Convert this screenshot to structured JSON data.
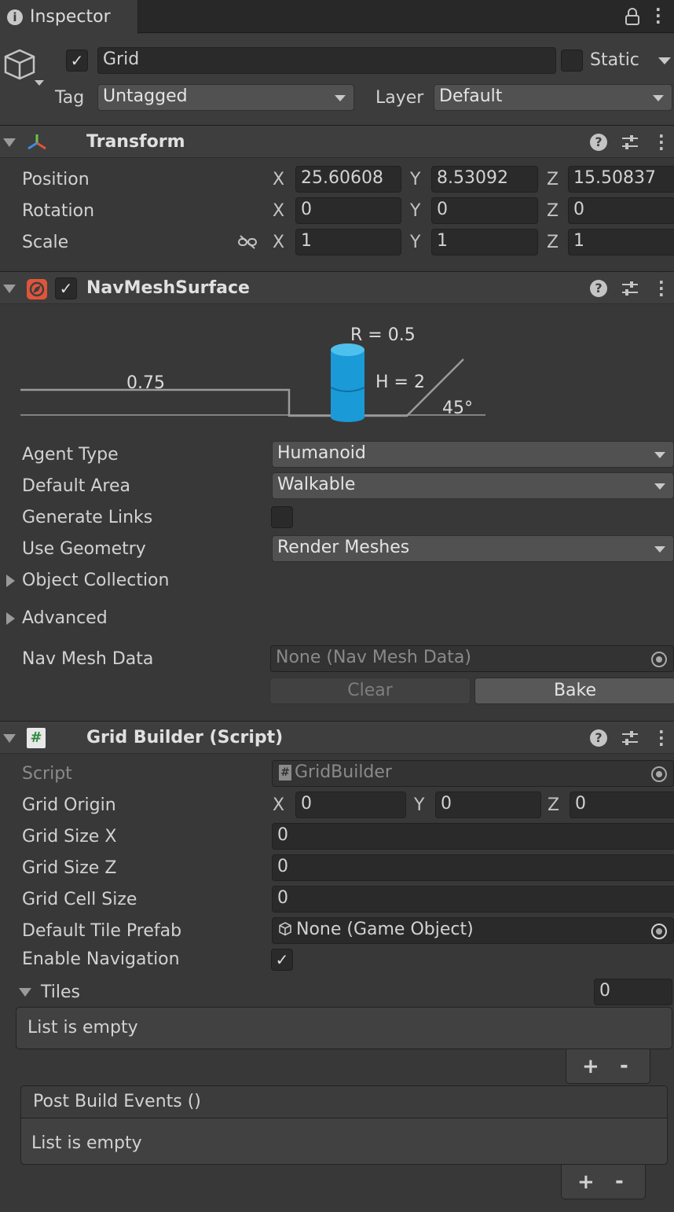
{
  "tab": {
    "title": "Inspector",
    "info_icon": "info-icon",
    "lock_icon": "lock-icon",
    "menu_icon": "kebab-menu-icon"
  },
  "object": {
    "active": true,
    "name": "Grid",
    "static_label": "Static",
    "static_checked": false,
    "tag_label": "Tag",
    "tag_value": "Untagged",
    "layer_label": "Layer",
    "layer_value": "Default"
  },
  "transform": {
    "title": "Transform",
    "rows": [
      {
        "label": "Position",
        "x": "25.60608",
        "y": "8.53092",
        "z": "15.50837"
      },
      {
        "label": "Rotation",
        "x": "0",
        "y": "0",
        "z": "0"
      },
      {
        "label": "Scale",
        "x": "1",
        "y": "1",
        "z": "1"
      }
    ],
    "axes": {
      "x": "X",
      "y": "Y",
      "z": "Z"
    }
  },
  "navmesh": {
    "title": "NavMeshSurface",
    "enabled": true,
    "diagram": {
      "radius": "R = 0.5",
      "height": "H = 2",
      "step": "0.75",
      "slope": "45°"
    },
    "agent_type_label": "Agent Type",
    "agent_type_value": "Humanoid",
    "default_area_label": "Default Area",
    "default_area_value": "Walkable",
    "generate_links_label": "Generate Links",
    "generate_links_checked": false,
    "use_geometry_label": "Use Geometry",
    "use_geometry_value": "Render Meshes",
    "object_collection_label": "Object Collection",
    "advanced_label": "Advanced",
    "nav_mesh_data_label": "Nav Mesh Data",
    "nav_mesh_data_value": "None (Nav Mesh Data)",
    "clear_label": "Clear",
    "bake_label": "Bake"
  },
  "grid_builder": {
    "title": "Grid Builder (Script)",
    "script_label": "Script",
    "script_value": "GridBuilder",
    "grid_origin_label": "Grid Origin",
    "grid_origin": {
      "x": "0",
      "y": "0",
      "z": "0"
    },
    "grid_size_x_label": "Grid Size X",
    "grid_size_x_value": "0",
    "grid_size_z_label": "Grid Size Z",
    "grid_size_z_value": "0",
    "grid_cell_size_label": "Grid Cell Size",
    "grid_cell_size_value": "0",
    "default_tile_prefab_label": "Default Tile Prefab",
    "default_tile_prefab_value": "None (Game Object)",
    "enable_navigation_label": "Enable Navigation",
    "enable_navigation_checked": true,
    "tiles_label": "Tiles",
    "tiles_count": "0",
    "tiles_empty_text": "List is empty",
    "post_build_events_label": "Post Build Events ()",
    "events_empty_text": "List is empty",
    "add_label": "+",
    "remove_label": "-"
  }
}
